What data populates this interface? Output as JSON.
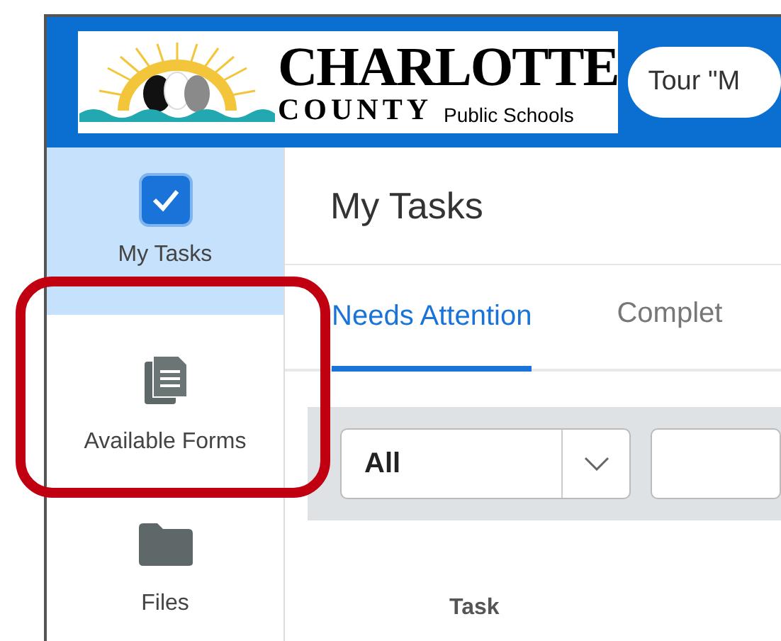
{
  "header": {
    "logo": {
      "line_1": "CHARLOTTE",
      "line_2": "COUNTY",
      "line_3": "Public Schools"
    },
    "search": {
      "value": "Tour \"M"
    }
  },
  "sidebar": {
    "items": [
      {
        "label": "My Tasks",
        "kind": "check",
        "selected": true
      },
      {
        "label": "Available Forms",
        "kind": "forms",
        "selected": false
      },
      {
        "label": "Files",
        "kind": "folder",
        "selected": false
      }
    ]
  },
  "page_title": "My Tasks",
  "tabs": [
    {
      "label": "Needs Attention",
      "selected": true
    },
    {
      "label": "Complet",
      "selected": false
    }
  ],
  "filter": {
    "dropdown_value": "All"
  },
  "table": {
    "columns": [
      "Task"
    ]
  }
}
